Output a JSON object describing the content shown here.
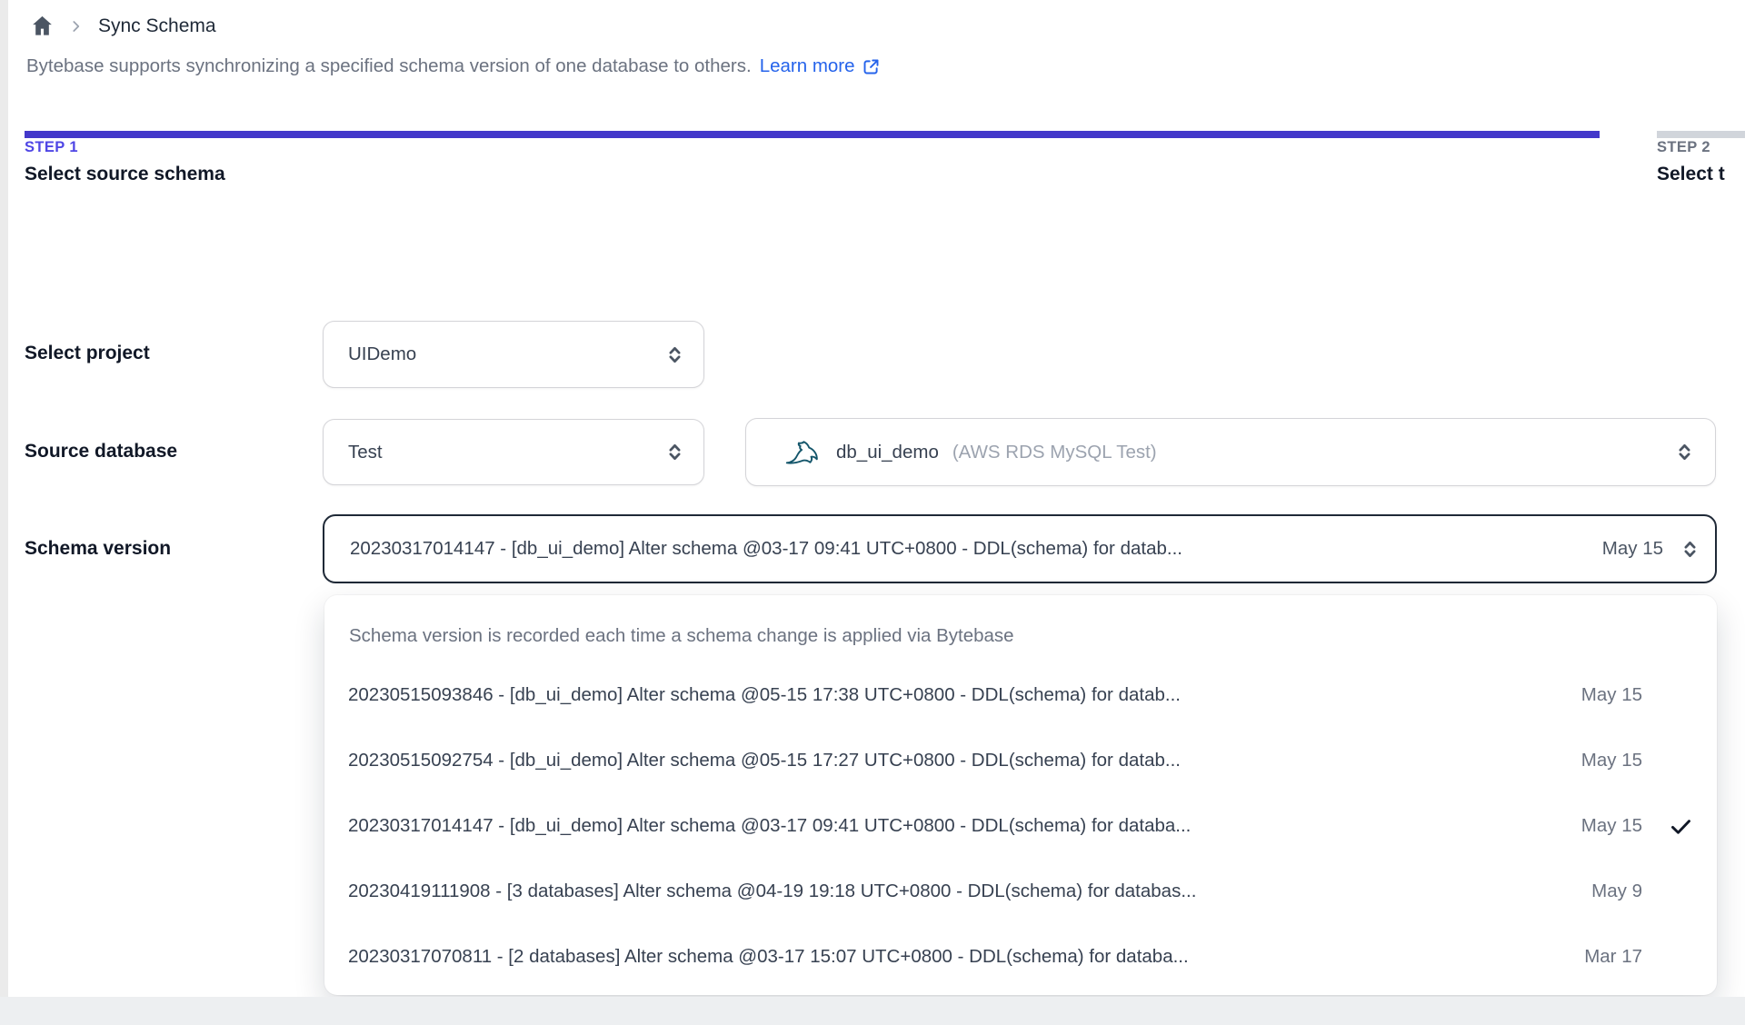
{
  "breadcrumb": {
    "title": "Sync Schema"
  },
  "intro": {
    "text": "Bytebase supports synchronizing a specified schema version of one database to others.",
    "link_label": "Learn more"
  },
  "steps": {
    "step1": {
      "label": "STEP 1",
      "title": "Select source schema"
    },
    "step2": {
      "label": "STEP 2",
      "title": "Select t"
    }
  },
  "form": {
    "project": {
      "label": "Select project",
      "value": "UIDemo"
    },
    "source_database": {
      "label": "Source database",
      "environment_value": "Test",
      "database_value": "db_ui_demo",
      "database_annotation": "(AWS RDS MySQL Test)"
    },
    "schema_version": {
      "label": "Schema version",
      "value": "20230317014147 - [db_ui_demo] Alter schema @03-17 09:41 UTC+0800 - DDL(schema) for datab...",
      "date": "May 15"
    }
  },
  "dropdown": {
    "hint": "Schema version is recorded each time a schema change is applied via Bytebase",
    "options": [
      {
        "text": "20230515093846 - [db_ui_demo] Alter schema @05-15 17:38 UTC+0800 - DDL(schema) for datab...",
        "date": "May 15",
        "selected": false
      },
      {
        "text": "20230515092754 - [db_ui_demo] Alter schema @05-15 17:27 UTC+0800 - DDL(schema) for datab...",
        "date": "May 15",
        "selected": false
      },
      {
        "text": "20230317014147 - [db_ui_demo] Alter schema @03-17 09:41 UTC+0800 - DDL(schema) for databa...",
        "date": "May 15",
        "selected": true
      },
      {
        "text": "20230419111908 - [3 databases] Alter schema @04-19 19:18 UTC+0800 - DDL(schema) for databas...",
        "date": "May 9",
        "selected": false
      },
      {
        "text": "20230317070811 - [2 databases] Alter schema @03-17 15:07 UTC+0800 - DDL(schema) for databa...",
        "date": "Mar 17",
        "selected": false
      }
    ]
  },
  "icons": {
    "home": "home-icon",
    "breadcrumb_separator": "chevron-right-icon",
    "external_link": "external-link-icon",
    "select_toggle": "updown-chevron-icon",
    "database_engine": "mysql-dolphin-icon",
    "selected_mark": "check-icon"
  },
  "colors": {
    "accent_indigo": "#4f46e5",
    "progress_active": "#4338ca",
    "progress_inactive": "#d1d5db",
    "link_blue": "#2563eb",
    "mysql_teal": "#14566b",
    "focused_border": "#1f2937"
  }
}
